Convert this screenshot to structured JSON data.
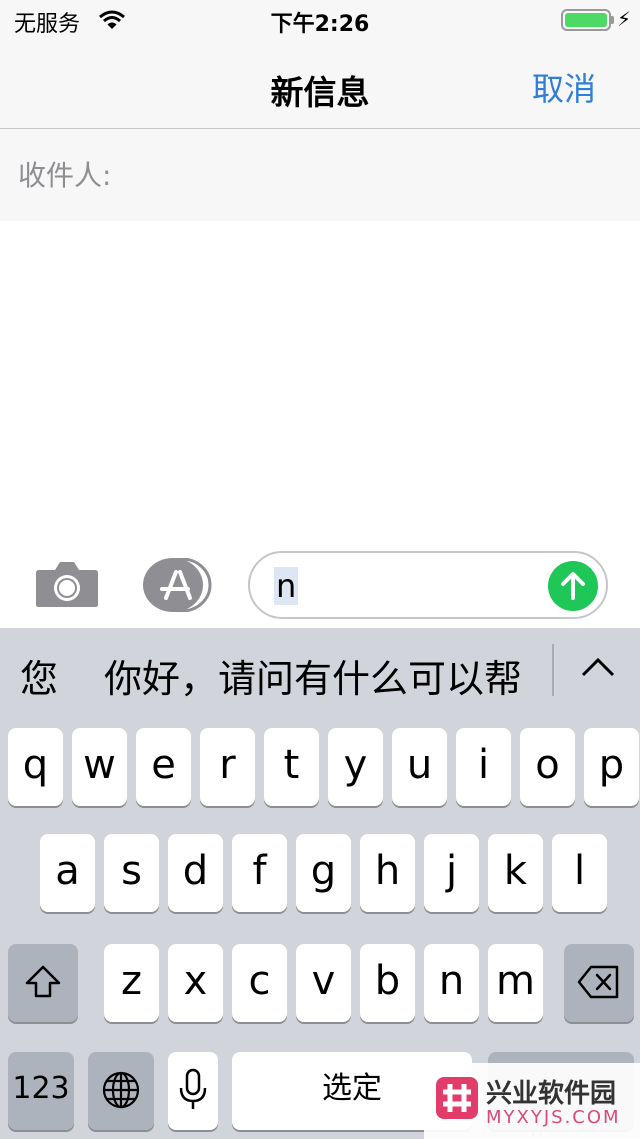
{
  "status_bar": {
    "carrier": "无服务",
    "time": "下午2:26",
    "battery_color": "#4cd964"
  },
  "nav": {
    "title": "新信息",
    "cancel_label": "取消",
    "accent": "#2f7ed8"
  },
  "recipients": {
    "to_label": "收件人:"
  },
  "compose": {
    "camera_icon": "camera-icon",
    "appstore_icon": "app-store-icon",
    "input_value": "n",
    "send_icon": "arrow-up-icon",
    "send_color": "#1ec756"
  },
  "keyboard": {
    "candidates": [
      "您",
      "你好，请问有什么可以帮"
    ],
    "row1": [
      "q",
      "w",
      "e",
      "r",
      "t",
      "y",
      "u",
      "i",
      "o",
      "p"
    ],
    "row2": [
      "a",
      "s",
      "d",
      "f",
      "g",
      "h",
      "j",
      "k",
      "l"
    ],
    "row3": [
      "z",
      "x",
      "c",
      "v",
      "b",
      "n",
      "m"
    ],
    "numbers_label": "123",
    "space_label": "选定"
  },
  "watermark": {
    "title": "兴业软件园",
    "url": "MYXYJS.COM"
  }
}
